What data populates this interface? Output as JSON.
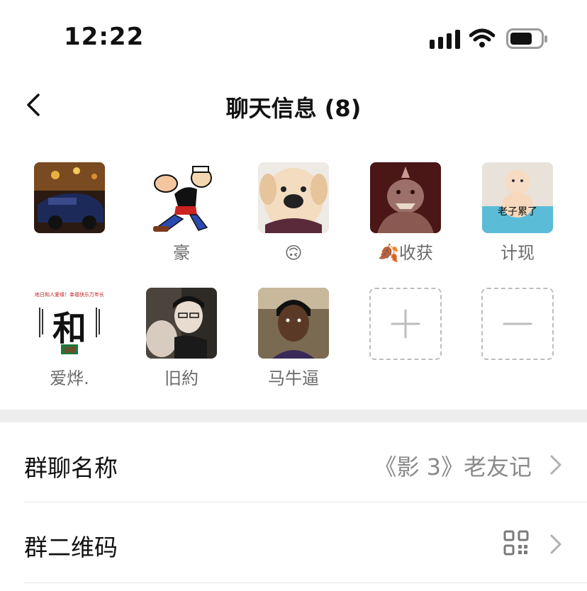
{
  "status": {
    "time": "12:22"
  },
  "header": {
    "title": "聊天信息 (8)"
  },
  "members": [
    {
      "name": "",
      "avatar": "car-photo-avatar"
    },
    {
      "name": "豪",
      "avatar": "popeye-cartoon-avatar"
    },
    {
      "name": "🙃",
      "avatar": "puppy-avatar"
    },
    {
      "name": "🍂收获",
      "avatar": "monster-avatar"
    },
    {
      "name": "计现",
      "avatar": "baby-avatar"
    },
    {
      "name": "爱烨.",
      "avatar": "calligraphy-avatar",
      "avatar_text": {
        "top": "天地日和人爱缘！幸福快乐万年长！",
        "main": "和",
        "sub": "温暖"
      }
    },
    {
      "name": "旧約",
      "avatar": "person-photo-avatar"
    },
    {
      "name": "马牛逼",
      "avatar": "face-photo-avatar"
    }
  ],
  "baby_caption": "老子累了",
  "settings": {
    "group_name_label": "群聊名称",
    "group_name_value": "《影 3》老友记",
    "qr_label": "群二维码"
  },
  "colors": {
    "band": "#ededed",
    "secondary_text": "#8a8a8a"
  }
}
